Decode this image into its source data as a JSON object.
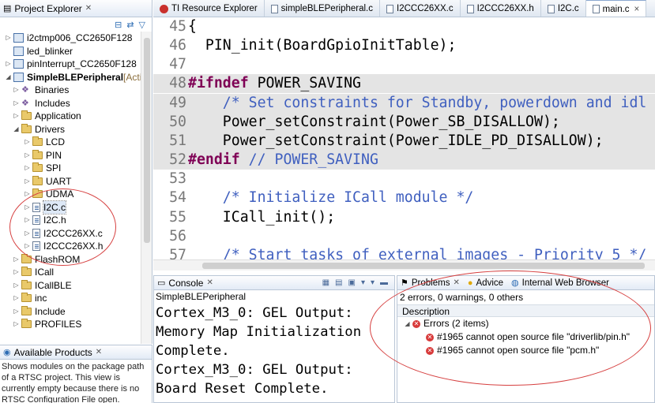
{
  "project_explorer": {
    "title": "Project Explorer",
    "tree": [
      {
        "label": "i2ctmp006_CC2650F128",
        "kind": "project",
        "indent": 0,
        "twisty": "▷"
      },
      {
        "label": "led_blinker",
        "kind": "project",
        "indent": 0,
        "twisty": ""
      },
      {
        "label": "pinInterrupt_CC2650F128",
        "kind": "project",
        "indent": 0,
        "twisty": "▷"
      },
      {
        "label": "SimpleBLEPeripheral",
        "suffix": " [Acti",
        "kind": "project",
        "indent": 0,
        "twisty": "◢",
        "bold": true
      },
      {
        "label": "Binaries",
        "kind": "bin",
        "indent": 1,
        "twisty": "▷"
      },
      {
        "label": "Includes",
        "kind": "bin",
        "indent": 1,
        "twisty": "▷"
      },
      {
        "label": "Application",
        "kind": "folder",
        "indent": 1,
        "twisty": "▷"
      },
      {
        "label": "Drivers",
        "kind": "folder",
        "indent": 1,
        "twisty": "◢"
      },
      {
        "label": "LCD",
        "kind": "folder",
        "indent": 2,
        "twisty": "▷"
      },
      {
        "label": "PIN",
        "kind": "folder",
        "indent": 2,
        "twisty": "▷"
      },
      {
        "label": "SPI",
        "kind": "folder",
        "indent": 2,
        "twisty": "▷"
      },
      {
        "label": "UART",
        "kind": "folder",
        "indent": 2,
        "twisty": "▷"
      },
      {
        "label": "UDMA",
        "kind": "folder",
        "indent": 2,
        "twisty": "▷"
      },
      {
        "label": "I2C.c",
        "kind": "file",
        "indent": 2,
        "twisty": "▷",
        "selected": true
      },
      {
        "label": "I2C.h",
        "kind": "file",
        "indent": 2,
        "twisty": "▷"
      },
      {
        "label": "I2CCC26XX.c",
        "kind": "file",
        "indent": 2,
        "twisty": "▷"
      },
      {
        "label": "I2CCC26XX.h",
        "kind": "file",
        "indent": 2,
        "twisty": "▷"
      },
      {
        "label": "FlashROM",
        "kind": "folder",
        "indent": 1,
        "twisty": "▷"
      },
      {
        "label": "ICall",
        "kind": "folder",
        "indent": 1,
        "twisty": "▷"
      },
      {
        "label": "ICallBLE",
        "kind": "folder",
        "indent": 1,
        "twisty": "▷"
      },
      {
        "label": "inc",
        "kind": "folder",
        "indent": 1,
        "twisty": "▷"
      },
      {
        "label": "Include",
        "kind": "folder",
        "indent": 1,
        "twisty": "▷"
      },
      {
        "label": "PROFILES",
        "kind": "folder",
        "indent": 1,
        "twisty": "▷"
      }
    ]
  },
  "available_products": {
    "title": "Available Products",
    "text": "Shows modules on the package path of a RTSC project. This view is currently empty because there is no RTSC Configuration File open."
  },
  "editor_tabs": [
    {
      "label": "TI Resource Explorer",
      "icon": "ti-icon",
      "active": false
    },
    {
      "label": "simpleBLEPeripheral.c",
      "icon": "file",
      "active": false
    },
    {
      "label": "I2CCC26XX.c",
      "icon": "file",
      "active": false
    },
    {
      "label": "I2CCC26XX.h",
      "icon": "file",
      "active": false
    },
    {
      "label": "I2C.c",
      "icon": "file",
      "active": false
    },
    {
      "label": "main.c",
      "icon": "file",
      "active": true,
      "close": "×"
    }
  ],
  "code": [
    {
      "n": "45",
      "text": "{",
      "gray": false
    },
    {
      "n": "46",
      "text": "  PIN_init(BoardGpioInitTable);",
      "gray": false
    },
    {
      "n": "47",
      "text": "",
      "gray": false
    },
    {
      "n": "48",
      "kw": "#ifndef",
      "text": " POWER_SAVING",
      "gray": true
    },
    {
      "n": "49",
      "cm": "    /* Set constraints for Standby, powerdown and idl",
      "gray": true
    },
    {
      "n": "50",
      "text": "    Power_setConstraint(Power_SB_DISALLOW);",
      "gray": true
    },
    {
      "n": "51",
      "text": "    Power_setConstraint(Power_IDLE_PD_DISALLOW);",
      "gray": true
    },
    {
      "n": "52",
      "kw": "#endif",
      "cm": " // POWER_SAVING",
      "gray": true
    },
    {
      "n": "53",
      "text": "",
      "gray": false
    },
    {
      "n": "54",
      "cm": "    /* Initialize ICall module */",
      "gray": false
    },
    {
      "n": "55",
      "text": "    ICall_init();",
      "gray": false
    },
    {
      "n": "56",
      "text": "",
      "gray": false
    },
    {
      "n": "57",
      "cm": "    /* Start tasks of external images - Priority 5 */",
      "gray": false
    }
  ],
  "console": {
    "title": "Console",
    "subtitle": "SimpleBLEPeripheral",
    "lines": [
      "Cortex_M3_0: GEL Output:",
      "Memory Map Initialization",
      "Complete.",
      "Cortex_M3_0: GEL Output:",
      "Board Reset Complete."
    ]
  },
  "problems": {
    "tabs": [
      "Problems",
      "Advice",
      "Internal Web Browser"
    ],
    "summary": "2 errors, 0 warnings, 0 others",
    "column": "Description",
    "group": "Errors (2 items)",
    "items": [
      "#1965 cannot open source file \"driverlib/pin.h\"",
      "#1965 cannot open source file \"pcm.h\""
    ]
  },
  "colors": {
    "annotation": "#d64040",
    "keyword": "#7f0055",
    "comment": "#3f5fbf",
    "inactive_code_bg": "#e4e4e4"
  }
}
